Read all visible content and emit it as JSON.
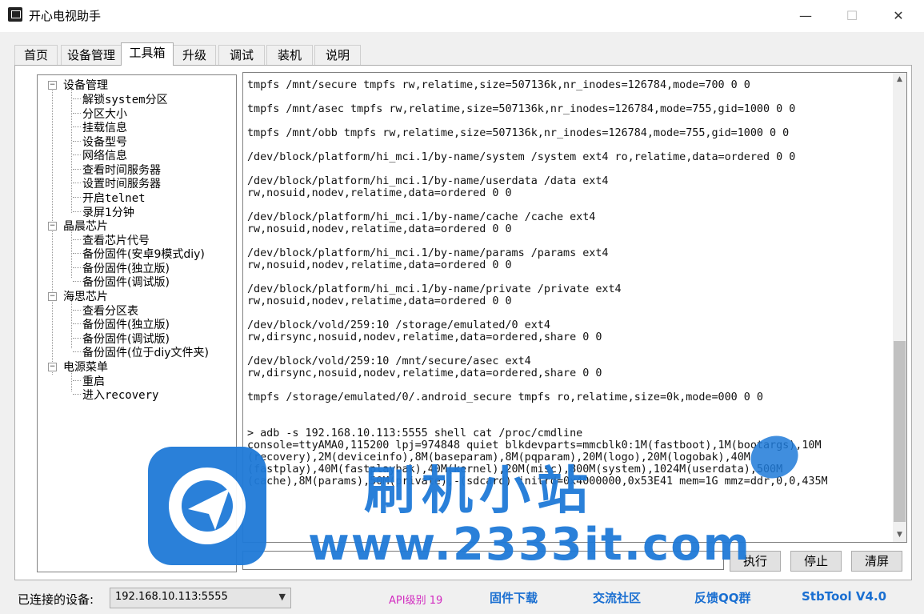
{
  "window": {
    "title": "开心电视助手",
    "minimize": "—",
    "maximize": "☐",
    "close": "✕"
  },
  "tabs": [
    {
      "label": "首页"
    },
    {
      "label": "设备管理"
    },
    {
      "label": "工具箱"
    },
    {
      "label": "升级"
    },
    {
      "label": "调试"
    },
    {
      "label": "装机"
    },
    {
      "label": "说明"
    }
  ],
  "active_tab": "工具箱",
  "tree": {
    "groups": [
      {
        "label": "设备管理",
        "items": [
          "解锁system分区",
          "分区大小",
          "挂载信息",
          "设备型号",
          "网络信息",
          "查看时间服务器",
          "设置时间服务器",
          "开启telnet",
          "录屏1分钟"
        ]
      },
      {
        "label": "晶晨芯片",
        "items": [
          "查看芯片代号",
          "备份固件(安卓9模式diy)",
          "备份固件(独立版)",
          "备份固件(调试版)"
        ]
      },
      {
        "label": "海思芯片",
        "items": [
          "查看分区表",
          "备份固件(独立版)",
          "备份固件(调试版)",
          "备份固件(位于diy文件夹)"
        ]
      },
      {
        "label": "电源菜单",
        "items": [
          "重启",
          "进入recovery"
        ]
      }
    ],
    "toggle_symbol": "−"
  },
  "console": {
    "lines": [
      "tmpfs /mnt/secure tmpfs rw,relatime,size=507136k,nr_inodes=126784,mode=700 0 0",
      "",
      "tmpfs /mnt/asec tmpfs rw,relatime,size=507136k,nr_inodes=126784,mode=755,gid=1000 0 0",
      "",
      "tmpfs /mnt/obb tmpfs rw,relatime,size=507136k,nr_inodes=126784,mode=755,gid=1000 0 0",
      "",
      "/dev/block/platform/hi_mci.1/by-name/system /system ext4 ro,relatime,data=ordered 0 0",
      "",
      "/dev/block/platform/hi_mci.1/by-name/userdata /data ext4",
      "rw,nosuid,nodev,relatime,data=ordered 0 0",
      "",
      "/dev/block/platform/hi_mci.1/by-name/cache /cache ext4",
      "rw,nosuid,nodev,relatime,data=ordered 0 0",
      "",
      "/dev/block/platform/hi_mci.1/by-name/params /params ext4",
      "rw,nosuid,nodev,relatime,data=ordered 0 0",
      "",
      "/dev/block/platform/hi_mci.1/by-name/private /private ext4",
      "rw,nosuid,nodev,relatime,data=ordered 0 0",
      "",
      "/dev/block/vold/259:10 /storage/emulated/0 ext4",
      "rw,dirsync,nosuid,nodev,relatime,data=ordered,share 0 0",
      "",
      "/dev/block/vold/259:10 /mnt/secure/asec ext4",
      "rw,dirsync,nosuid,nodev,relatime,data=ordered,share 0 0",
      "",
      "tmpfs /storage/emulated/0/.android_secure tmpfs ro,relatime,size=0k,mode=000 0 0",
      "",
      "",
      "> adb -s 192.168.10.113:5555 shell cat /proc/cmdline",
      "console=ttyAMA0,115200 lpj=974848 quiet blkdevparts=mmcblk0:1M(fastboot),1M(bootargs),10M",
      "(recovery),2M(deviceinfo),8M(baseparam),8M(pqparam),20M(logo),20M(logobak),40M",
      "(fastplay),40M(fastplaybak),40M(kernel),20M(misc),800M(system),1024M(userdata),500M",
      "(cache),8M(params),50M(private),-(sdcard) initrd=0x4000000,0x53E41 mem=1G mmz=ddr,0,0,435M"
    ]
  },
  "buttons": {
    "execute": "执行",
    "stop": "停止",
    "clear": "清屏"
  },
  "status": {
    "connected_label": "已连接的设备:",
    "device": "192.168.10.113:5555",
    "api_level": "API级别 19",
    "firmware_download": "固件下载",
    "community": "交流社区",
    "feedback": "反馈QQ群",
    "version": "StbTool V4.0"
  },
  "watermark": {
    "title": "刷机小站",
    "url": "www.2333it.com"
  },
  "colors": {
    "api": "#d22cc0",
    "link": "#1a6fd1",
    "watermark": "#1f7ad8"
  }
}
